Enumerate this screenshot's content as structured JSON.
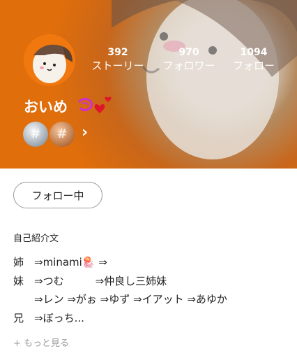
{
  "profile": {
    "username": "おいめ",
    "follow_button": "フォロー中",
    "badges": [
      "silver-badge",
      "bronze-badge"
    ],
    "badge_symbol": "#",
    "chevron": "›"
  },
  "stats": [
    {
      "count": "392",
      "label": "ストーリー"
    },
    {
      "count": "970",
      "label": "フォロワー"
    },
    {
      "count": "1094",
      "label": "フォロー"
    }
  ],
  "bio": {
    "title": "自己紹介文",
    "lines": [
      "姉　⇒minami🪼 ⇒",
      "妹　⇒つむ　　　⇒仲良し三姉妹",
      "　　⇒レン ⇒がぉ ⇒ゆず ⇒イアット ⇒あゆか",
      "兄　⇒ぼっち..."
    ],
    "more_label": "+ もっと見る"
  },
  "colors": {
    "header_orange": "#e06e0b",
    "text_dark": "#222222",
    "muted": "#9a9a9a"
  }
}
